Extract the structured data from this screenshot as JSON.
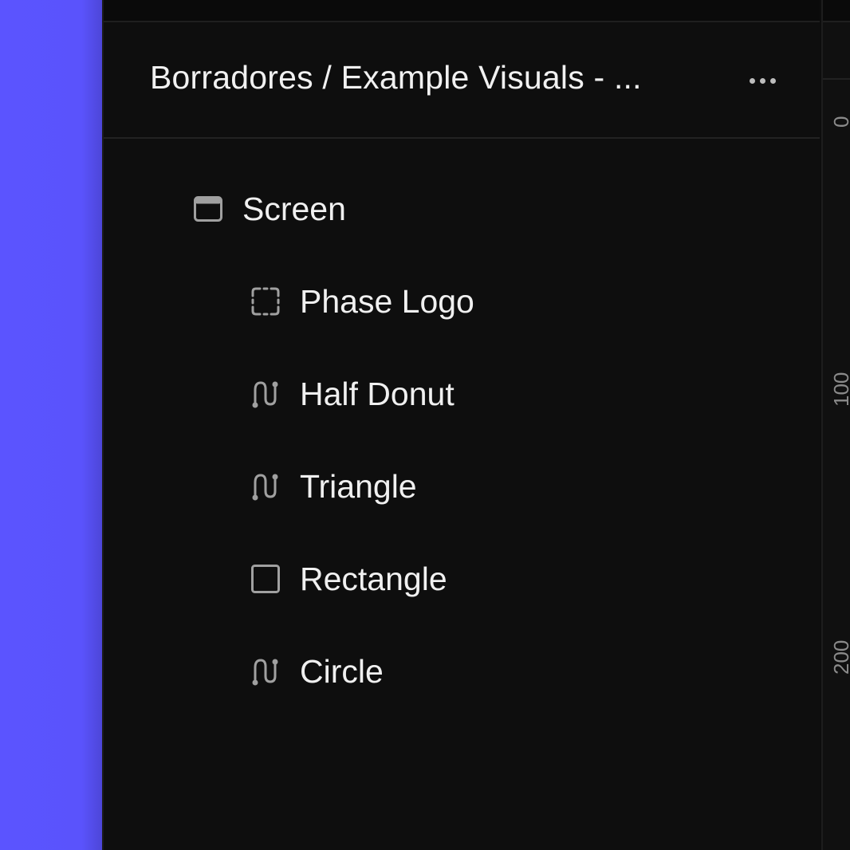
{
  "header": {
    "breadcrumb": "Borradores / Example Visuals - ...",
    "more_icon": "more-horizontal-icon"
  },
  "layers": [
    {
      "label": "Screen",
      "icon": "frame-icon"
    },
    {
      "label": "Phase Logo",
      "icon": "group-dashed-icon"
    },
    {
      "label": "Half Donut",
      "icon": "path-icon"
    },
    {
      "label": "Triangle",
      "icon": "path-icon"
    },
    {
      "label": "Rectangle",
      "icon": "rectangle-icon"
    },
    {
      "label": "Circle",
      "icon": "path-icon"
    }
  ],
  "ruler": {
    "ticks": [
      "0",
      "100",
      "200"
    ]
  },
  "colors": {
    "accent_canvas": "#5b54ff",
    "panel_bg": "#0e0e0e",
    "text": "#f0f0f0",
    "icon": "#a0a0a0"
  }
}
